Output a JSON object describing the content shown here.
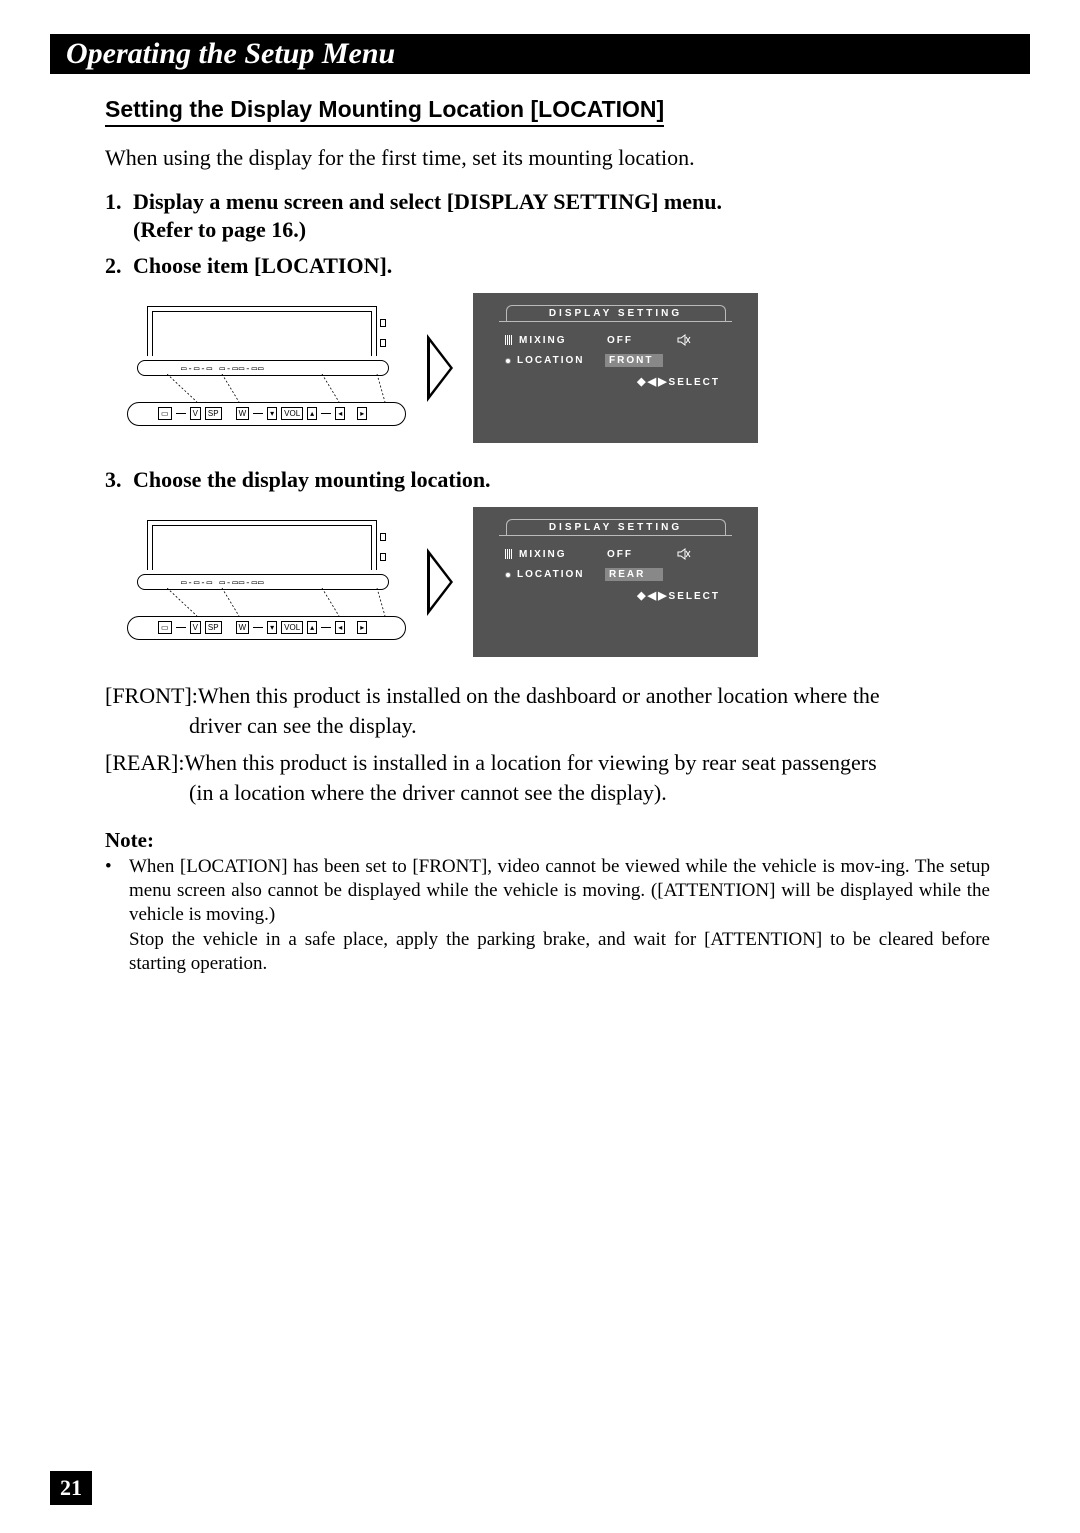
{
  "header": {
    "title": "Operating the Setup Menu"
  },
  "section": {
    "heading": "Setting the Display Mounting Location [LOCATION]"
  },
  "intro": "When using the display for the first time, set its mounting location.",
  "steps": {
    "s1_num": "1.",
    "s1_line1": "Display a menu screen and select [DISPLAY SETTING] menu.",
    "s1_line2": "(Refer to page 16.)",
    "s2_num": "2.",
    "s2_text": "Choose item [LOCATION].",
    "s3_num": "3.",
    "s3_text": "Choose the display mounting location."
  },
  "osd": {
    "title": "DISPLAY SETTING",
    "row1_label": "MIXING",
    "row1_value": "OFF",
    "row2_label": "LOCATION",
    "value_front": "FRONT",
    "value_rear": "REAR",
    "select": "SELECT"
  },
  "buttons": {
    "v": "V",
    "sp": "SP",
    "w": "W",
    "vol": "VOL"
  },
  "descriptions": {
    "front_tag": "[FRONT]: ",
    "front_text": "When this product is installed on the dashboard or another location where the",
    "front_cont": "driver can see the display.",
    "rear_tag": "[REAR]: ",
    "rear_text": "When this product is installed in a location for viewing by rear seat passengers",
    "rear_cont": "(in a location where the driver cannot see the display)."
  },
  "note": {
    "heading": "Note:",
    "bullet": "•",
    "text": "When [LOCATION] has been set to [FRONT], video cannot be viewed while the vehicle is mov-ing. The setup menu screen also cannot be displayed while the vehicle is moving. ([ATTENTION] will be displayed while the vehicle is moving.)\nStop the vehicle in a safe place, apply the parking brake, and wait for [ATTENTION] to be cleared before starting operation."
  },
  "page_number": "21"
}
